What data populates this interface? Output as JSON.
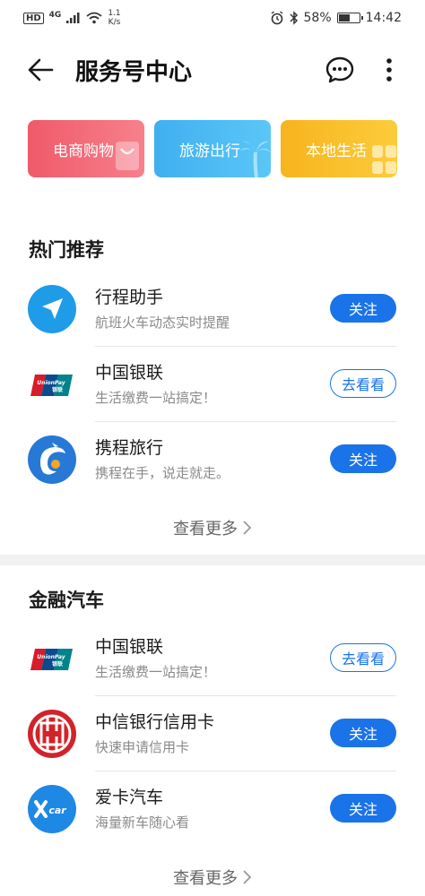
{
  "status_bar": {
    "hd": "HD",
    "network": "4G",
    "speed_value": "1.1",
    "speed_unit": "K/s",
    "battery_text": "58%",
    "battery_level": 0.58,
    "time": "14:42"
  },
  "header": {
    "title": "服务号中心"
  },
  "categories": [
    {
      "label": "电商购物",
      "color": "#f05a6a"
    },
    {
      "label": "旅游出行",
      "color": "#3fb0f0"
    },
    {
      "label": "本地生活",
      "color": "#f7b41e"
    }
  ],
  "hot": {
    "title": "热门推荐",
    "items": [
      {
        "name": "行程助手",
        "desc": "航班火车动态实时提醒",
        "action": "关注",
        "icon": "navigation-arrow-icon"
      },
      {
        "name": "中国银联",
        "desc": "生活缴费一站搞定！",
        "action": "去看看",
        "icon": "unionpay-logo-icon"
      },
      {
        "name": "携程旅行",
        "desc": "携程在手，说走就走。",
        "action": "关注",
        "icon": "ctrip-dolphin-icon"
      }
    ],
    "more_label": "查看更多"
  },
  "finance": {
    "title": "金融汽车",
    "items": [
      {
        "name": "中国银联",
        "desc": "生活缴费一站搞定！",
        "action": "去看看",
        "icon": "unionpay-logo-icon"
      },
      {
        "name": "中信银行信用卡",
        "desc": "快速申请信用卡",
        "action": "关注",
        "icon": "citic-bank-logo-icon"
      },
      {
        "name": "爱卡汽车",
        "desc": "海量新车随心看",
        "action": "关注",
        "icon": "xcar-logo-icon"
      }
    ],
    "more_label": "查看更多"
  },
  "colors": {
    "accent": "#1a73e8",
    "unionpay_red": "#d71c2c",
    "unionpay_blue": "#0c4a8f",
    "unionpay_green": "#00838a",
    "citic_red": "#d2232a",
    "xcar_blue": "#1e88e5"
  }
}
